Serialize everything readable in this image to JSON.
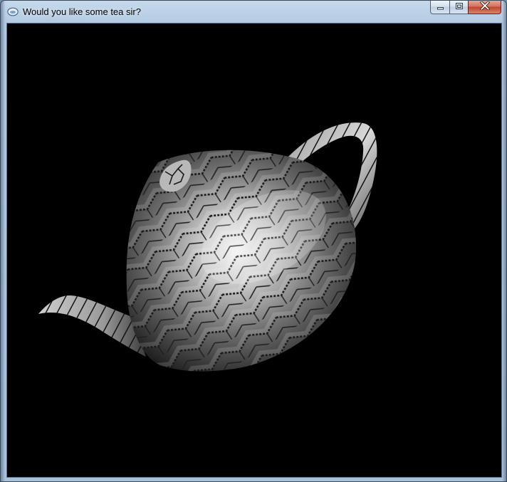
{
  "window": {
    "title": "Would you like some tea sir?",
    "background_color": "#000000",
    "accent_color": "#b4cbe2"
  },
  "titlebar": {
    "icons": {
      "app": "opengl-app-icon",
      "minimize": "minimize-icon",
      "maximize": "maximize-icon",
      "close": "close-icon"
    }
  },
  "viewport": {
    "content": "textured-teapot-render"
  }
}
